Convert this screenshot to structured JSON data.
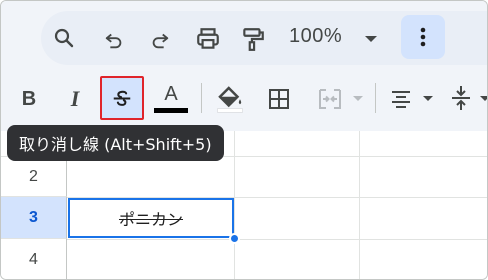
{
  "toolbar": {
    "zoom": "100%",
    "tooltip": "取り消し線 (Alt+Shift+5)",
    "bold_label": "B",
    "italic_label": "I",
    "text_color_label": "A",
    "text_color": "#000000",
    "icons": [
      "search-icon",
      "undo-icon",
      "redo-icon",
      "print-icon",
      "paint-format-icon",
      "zoom-dropdown-icon",
      "more-options-icon",
      "bold-icon",
      "italic-icon",
      "strikethrough-icon",
      "text-color-icon",
      "fill-color-icon",
      "borders-icon",
      "merge-cells-icon",
      "align-icon",
      "vertical-align-icon"
    ]
  },
  "grid": {
    "rows": [
      {
        "number": "2",
        "selected": false
      },
      {
        "number": "3",
        "selected": true
      },
      {
        "number": "4",
        "selected": false
      }
    ],
    "active_cell_value": "ポニカン"
  },
  "colors": {
    "selection": "#1a73e8",
    "highlight_border": "#e0242a",
    "button_active": "#d3e3fd"
  }
}
